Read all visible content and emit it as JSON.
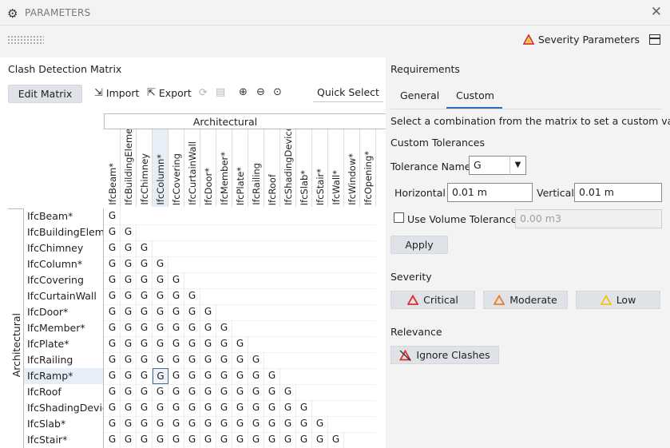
{
  "window": {
    "title": "PARAMETERS"
  },
  "top_toolbar": {
    "severity_parameters_label": "Severity Parameters"
  },
  "left_panel": {
    "title": "Clash Detection Matrix",
    "edit_matrix_label": "Edit Matrix",
    "import_label": "Import",
    "export_label": "Export",
    "quick_select_label": "Quick Select",
    "group_header": "Architectural",
    "row_group_label": "Architectural",
    "columns": [
      "IfcBeam*",
      "IfcBuildingEleme",
      "IfcChimney",
      "IfcColumn*",
      "IfcCovering",
      "IfcCurtainWall",
      "IfcDoor*",
      "IfcMember*",
      "IfcPlate*",
      "IfcRailing",
      "IfcRoof",
      "IfcShadingDevice",
      "IfcSlab*",
      "IfcStair*",
      "IfcWall*",
      "IfcWindow*",
      "IfcOpening*"
    ],
    "rows": [
      "IfcBeam*",
      "IfcBuildingEleme",
      "IfcChimney",
      "IfcColumn*",
      "IfcCovering",
      "IfcCurtainWall",
      "IfcDoor*",
      "IfcMember*",
      "IfcPlate*",
      "IfcRailing",
      "IfcRamp*",
      "IfcRoof",
      "IfcShadingDevice",
      "IfcSlab*",
      "IfcStair*"
    ],
    "cell_value": "G",
    "selected_row": "IfcRamp*",
    "selected_column": "IfcColumn*"
  },
  "right_panel": {
    "title": "Requirements",
    "tabs": [
      {
        "label": "General"
      },
      {
        "label": "Custom"
      }
    ],
    "active_tab": "Custom",
    "hint": "Select a combination from the matrix to set a custom value",
    "custom_tolerances_label": "Custom Tolerances",
    "tolerance_name_label": "Tolerance Name",
    "tolerance_name_value": "G",
    "horizontal_label": "Horizontal",
    "horizontal_value": "0.01 m",
    "vertical_label": "Vertical",
    "vertical_value": "0.01 m",
    "use_volume_label": "Use Volume Tolerance",
    "volume_value": "0.00 m3",
    "apply_label": "Apply",
    "severity_label": "Severity",
    "critical_label": "Critical",
    "moderate_label": "Moderate",
    "low_label": "Low",
    "relevance_label": "Relevance",
    "ignore_clashes_label": "Ignore Clashes"
  },
  "colors": {
    "critical": "#d9302c",
    "moderate": "#f07d22",
    "low": "#f2c21b",
    "accent": "#2e6bb4"
  }
}
